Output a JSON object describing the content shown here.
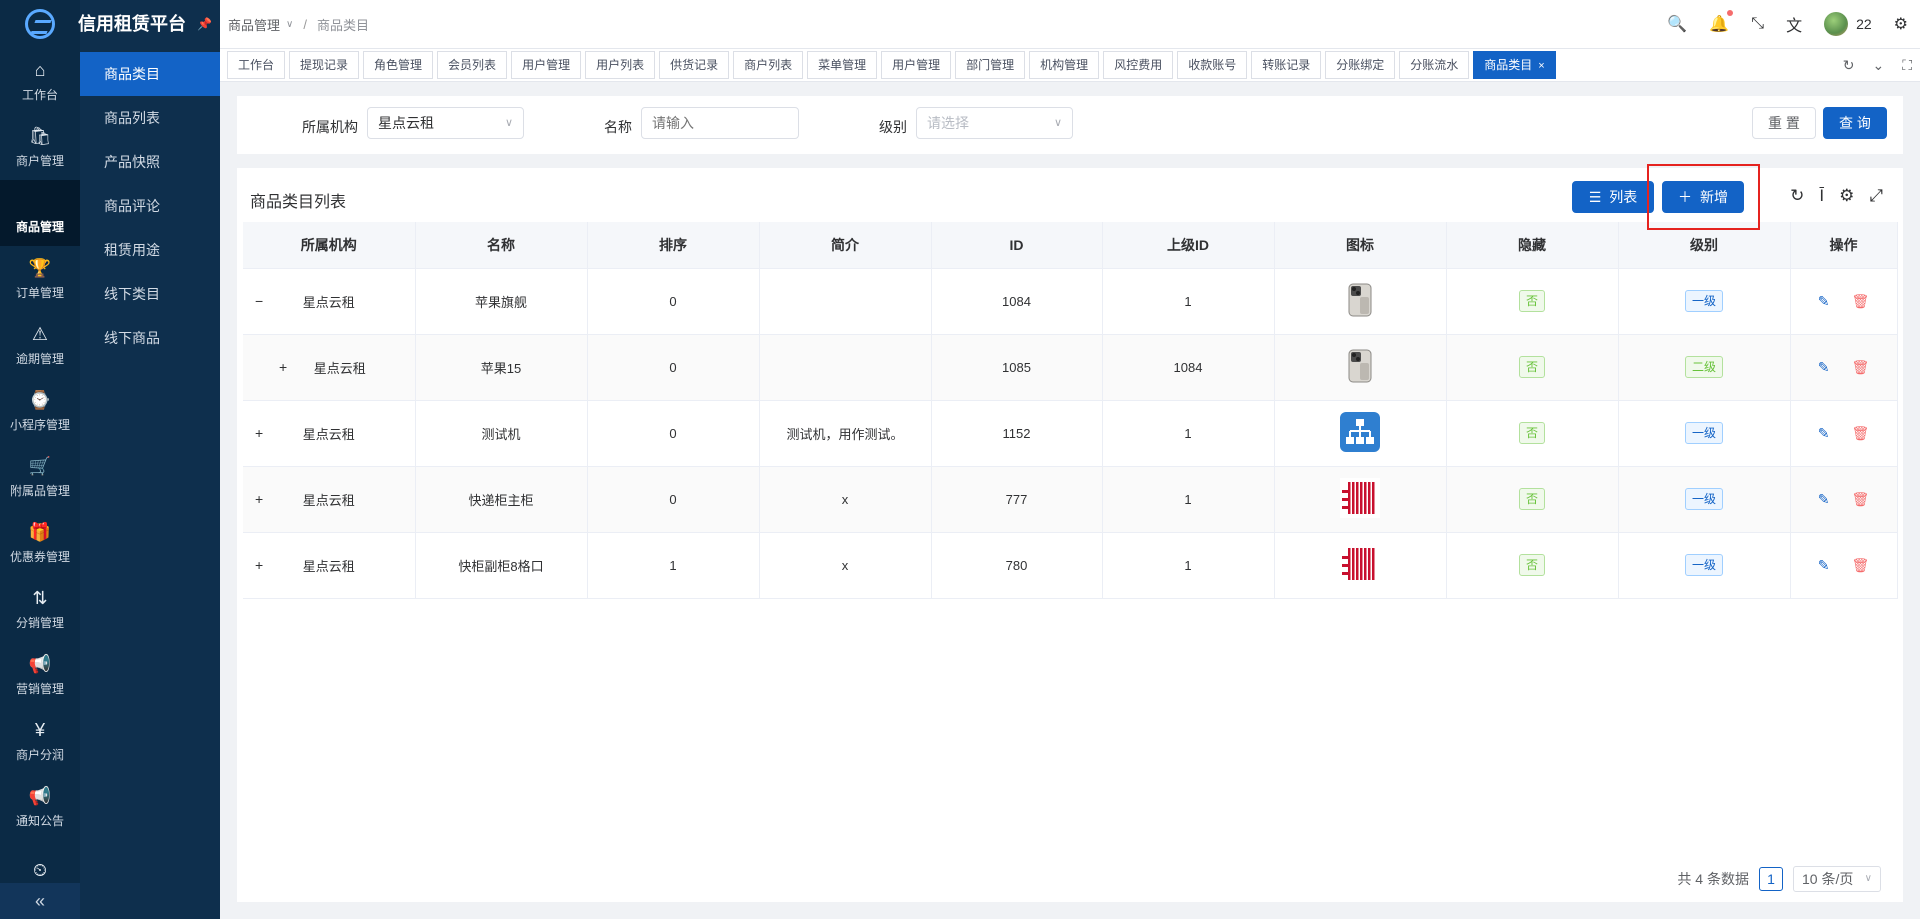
{
  "app": {
    "title": "信用租赁平台",
    "pin_icon": "pin-icon"
  },
  "rail": {
    "items": [
      {
        "label": "工作台",
        "icon": "home-icon",
        "glyph": "⌂"
      },
      {
        "label": "商户管理",
        "icon": "bag-icon",
        "glyph": "🛍"
      },
      {
        "label": "商品管理",
        "icon": "apple-icon",
        "glyph": ""
      },
      {
        "label": "订单管理",
        "icon": "trophy-icon",
        "glyph": "🏆"
      },
      {
        "label": "逾期管理",
        "icon": "alarm-icon",
        "glyph": "⚠"
      },
      {
        "label": "小程序管理",
        "icon": "watch-icon",
        "glyph": "⌚"
      },
      {
        "label": "附属品管理",
        "icon": "cart-icon",
        "glyph": "🛒"
      },
      {
        "label": "优惠券管理",
        "icon": "gift-icon",
        "glyph": "🎁"
      },
      {
        "label": "分销管理",
        "icon": "share-icon",
        "glyph": "⇅"
      },
      {
        "label": "营销管理",
        "icon": "megaphone-icon",
        "glyph": "📢"
      },
      {
        "label": "商户分润",
        "icon": "yen-icon",
        "glyph": "¥"
      },
      {
        "label": "通知公告",
        "icon": "bell-icon",
        "glyph": "📢"
      },
      {
        "label": "",
        "icon": "clock-icon",
        "glyph": "⏲"
      }
    ],
    "collapse_glyph": "«"
  },
  "submenu": {
    "items": [
      "商品类目",
      "商品列表",
      "产品快照",
      "商品评论",
      "租赁用途",
      "线下类目",
      "线下商品"
    ]
  },
  "breadcrumb": {
    "parent": "商品管理",
    "current": "商品类目"
  },
  "header": {
    "user": "22"
  },
  "tabs": [
    "工作台",
    "提现记录",
    "角色管理",
    "会员列表",
    "用户管理",
    "用户列表",
    "供货记录",
    "商户列表",
    "菜单管理",
    "用户管理",
    "部门管理",
    "机构管理",
    "风控费用",
    "收款账号",
    "转账记录",
    "分账绑定",
    "分账流水",
    "商品类目"
  ],
  "search": {
    "org_label": "所属机构",
    "org_value": "星点云租",
    "name_label": "名称",
    "name_placeholder": "请输入",
    "level_label": "级别",
    "level_placeholder": "请选择",
    "reset_label": "重 置",
    "query_label": "查 询"
  },
  "table": {
    "title": "商品类目列表",
    "list_button": "列表",
    "add_button": "新增",
    "columns": [
      "所属机构",
      "名称",
      "排序",
      "简介",
      "ID",
      "上级ID",
      "图标",
      "隐藏",
      "级别",
      "操作"
    ],
    "rows": [
      {
        "expander": "−",
        "org": "星点云租",
        "name": "苹果旗舰",
        "sort": "0",
        "desc": "",
        "id": "1084",
        "parent_id": "1",
        "icon": "phone-icon",
        "hidden": "否",
        "level": "一级",
        "indent": false
      },
      {
        "expander": "+",
        "org": "星点云租",
        "name": "苹果15",
        "sort": "0",
        "desc": "",
        "id": "1085",
        "parent_id": "1084",
        "icon": "phone-icon",
        "hidden": "否",
        "level": "二级",
        "indent": true
      },
      {
        "expander": "+",
        "org": "星点云租",
        "name": "测试机",
        "sort": "0",
        "desc": "测试机，用作测试。",
        "id": "1152",
        "parent_id": "1",
        "icon": "org-chart-icon",
        "hidden": "否",
        "level": "一级",
        "indent": false
      },
      {
        "expander": "+",
        "org": "星点云租",
        "name": "快递柜主柜",
        "sort": "0",
        "desc": "x",
        "id": "777",
        "parent_id": "1",
        "icon": "locker-icon",
        "hidden": "否",
        "level": "一级",
        "indent": false
      },
      {
        "expander": "+",
        "org": "星点云租",
        "name": "快柜副柜8格口",
        "sort": "1",
        "desc": "x",
        "id": "780",
        "parent_id": "1",
        "icon": "locker-icon",
        "hidden": "否",
        "level": "一级",
        "indent": false
      }
    ]
  },
  "pagination": {
    "total_text": "共 4 条数据",
    "page": "1",
    "page_size": "10 条/页"
  },
  "colors": {
    "primary": "#1363c6",
    "sidebar": "#0b2a45",
    "highlight": "#e5231f",
    "success": "#67c23a",
    "danger": "#f56c6c"
  }
}
